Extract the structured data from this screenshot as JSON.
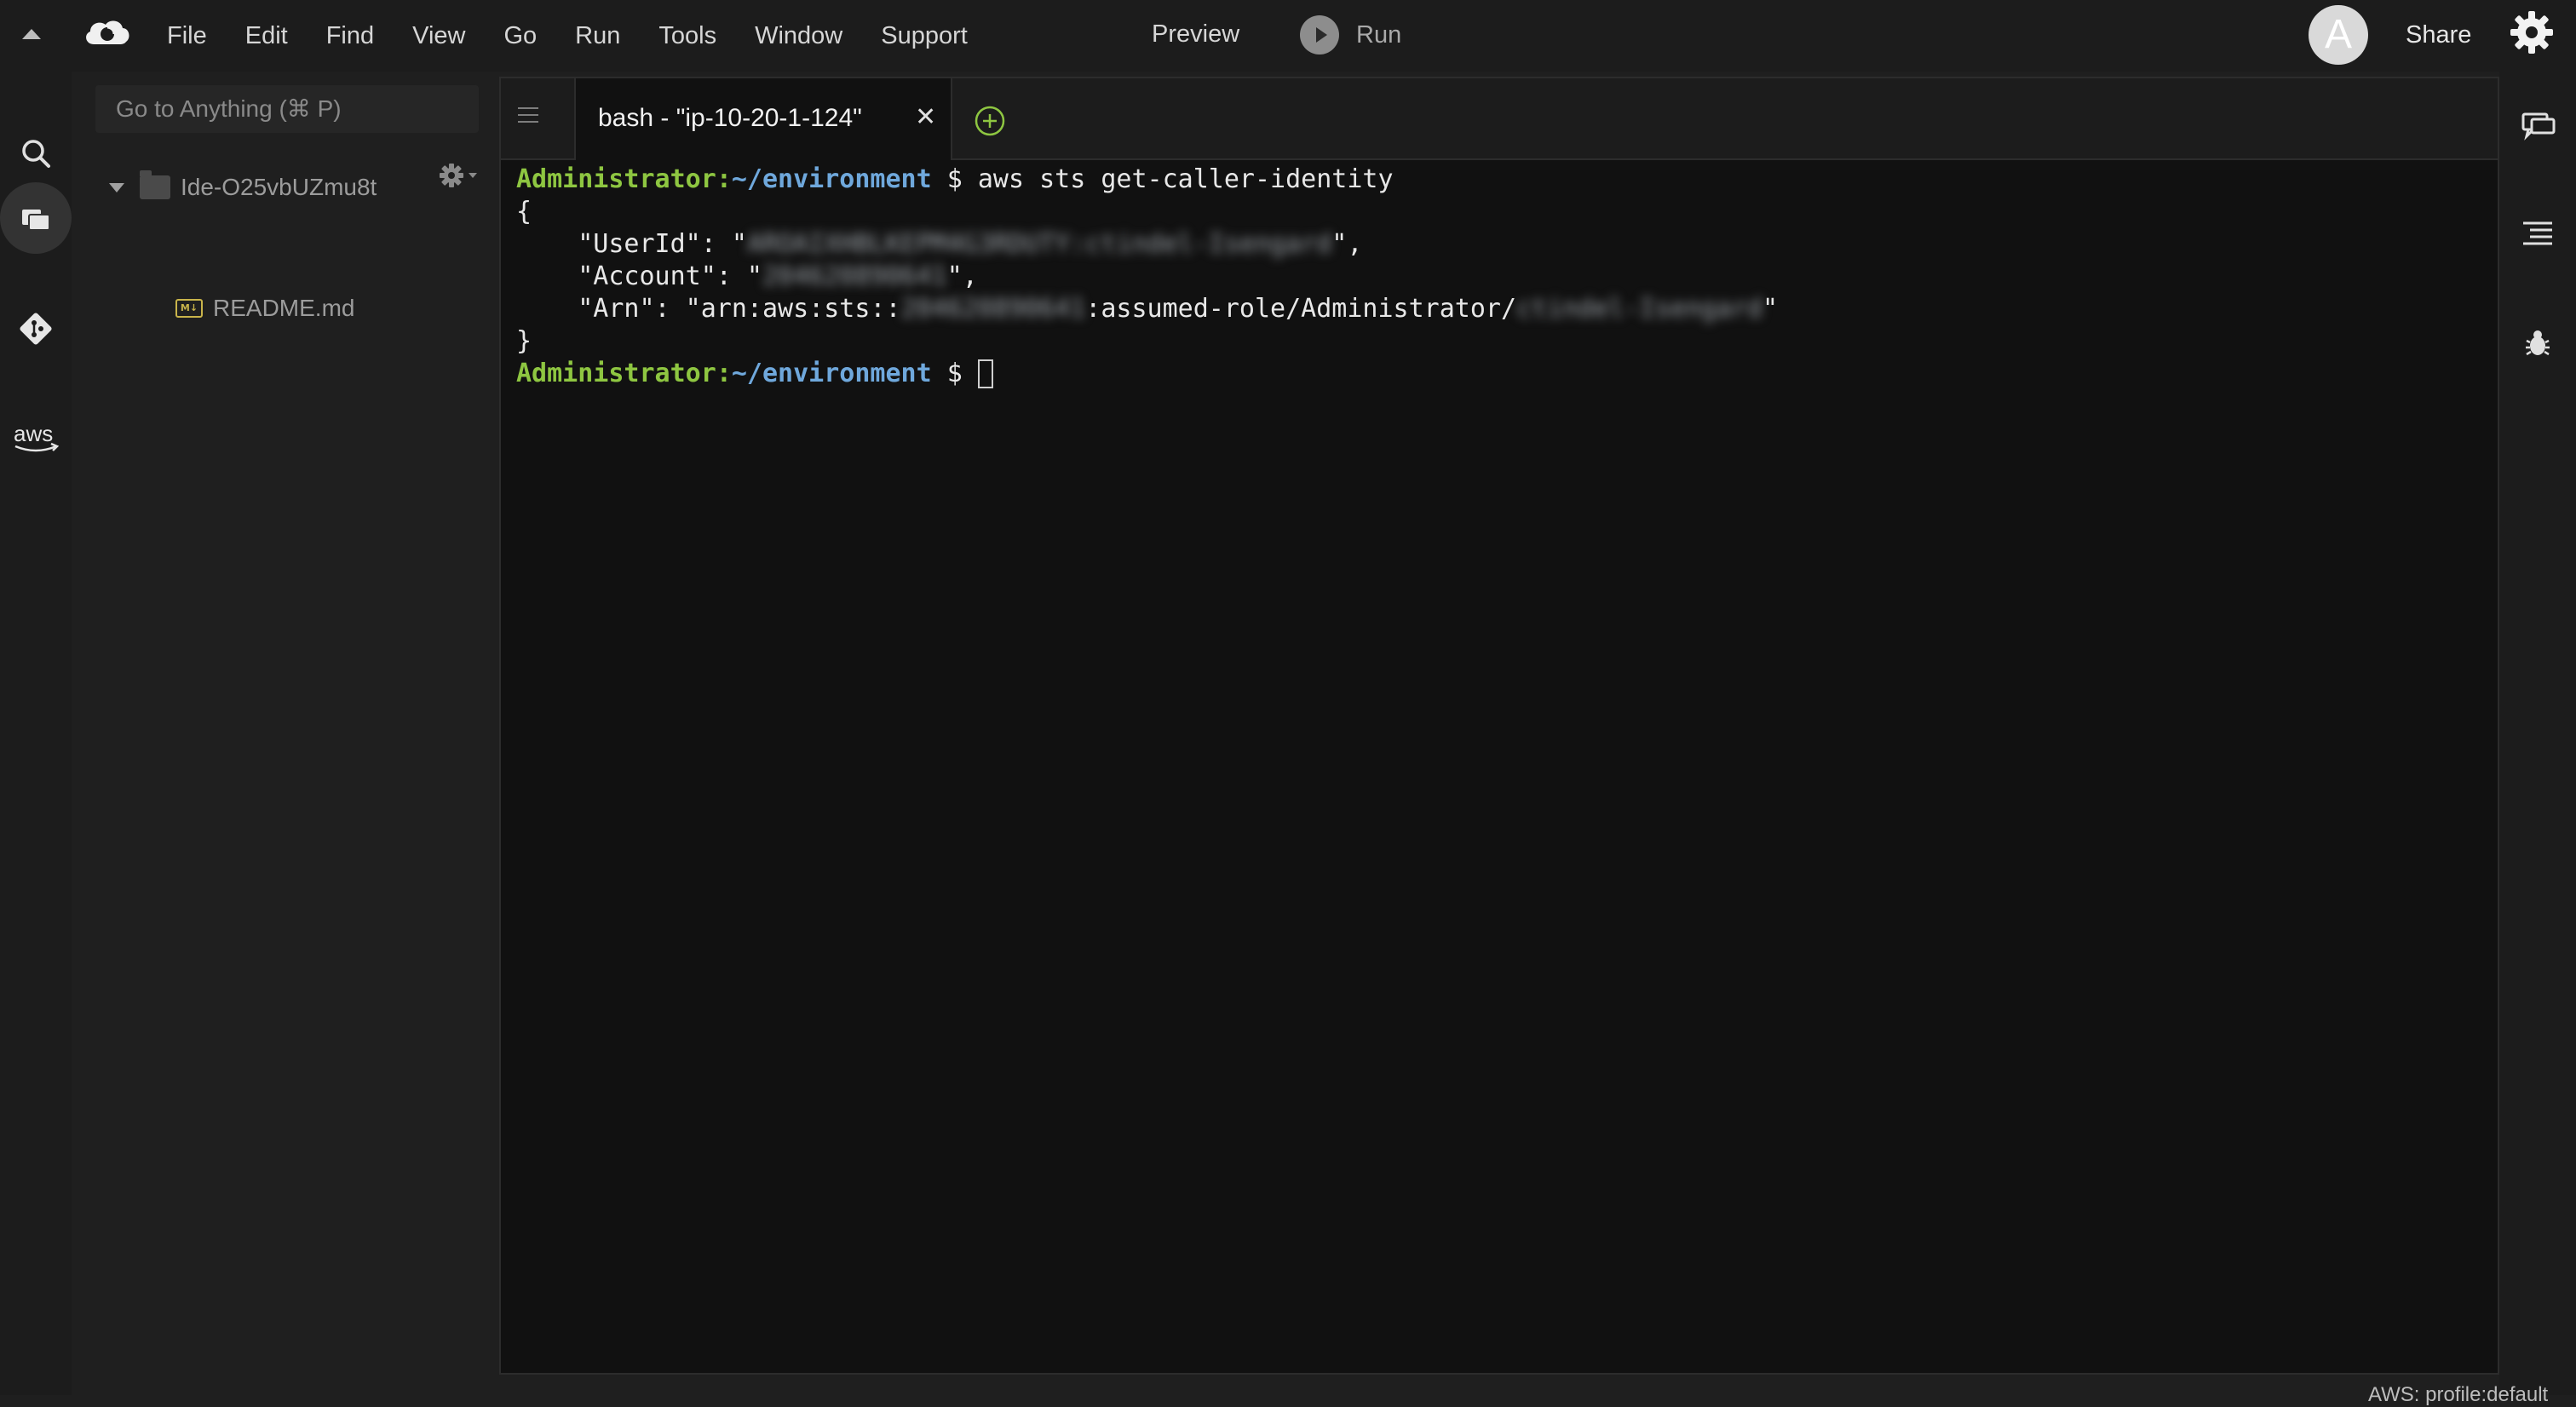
{
  "menu": {
    "items": [
      "File",
      "Edit",
      "Find",
      "View",
      "Go",
      "Run",
      "Tools",
      "Window",
      "Support"
    ],
    "preview_label": "Preview",
    "run_label": "Run",
    "avatar_letter": "A",
    "share_label": "Share"
  },
  "sidebar": {
    "search_placeholder": "Go to Anything (⌘ P)",
    "root_folder": "Ide-O25vbUZmu8t",
    "files": [
      "README.md"
    ],
    "md_badge": "M↓"
  },
  "tab": {
    "label": "bash - \"ip-10-20-1-124\"",
    "close_glyph": "✕"
  },
  "terminal": {
    "prompt_user": "Administrator",
    "prompt_sep": ":",
    "prompt_path": "~/environment",
    "prompt_symbol": "$",
    "command": "aws sts get-caller-identity",
    "open_brace": "{",
    "userid_key": "    \"UserId\": \"",
    "userid_value": "AROAIXHBLKEPM4G3RDUTY:ctindel-Isengard",
    "userid_end": "\",",
    "account_key": "    \"Account\": \"",
    "account_value": "204620890641",
    "account_end": "\",",
    "arn_key": "    \"Arn\": \"arn:aws:sts::",
    "arn_account": "204620890641",
    "arn_mid": ":assumed-role/Administrator/",
    "arn_session": "ctindel-Isengard",
    "arn_end": "\"",
    "close_brace": "}"
  },
  "status": {
    "text": "AWS: profile:default"
  },
  "colors": {
    "prompt_user": "#8ec641",
    "prompt_path": "#6fa8dc",
    "background": "#1f1f1f",
    "terminal_bg": "#111111"
  },
  "icons": {
    "left": [
      "search-icon",
      "folders-icon",
      "git-icon",
      "aws-icon"
    ],
    "right": [
      "chat-icon",
      "outline-icon",
      "debugger-icon"
    ]
  }
}
